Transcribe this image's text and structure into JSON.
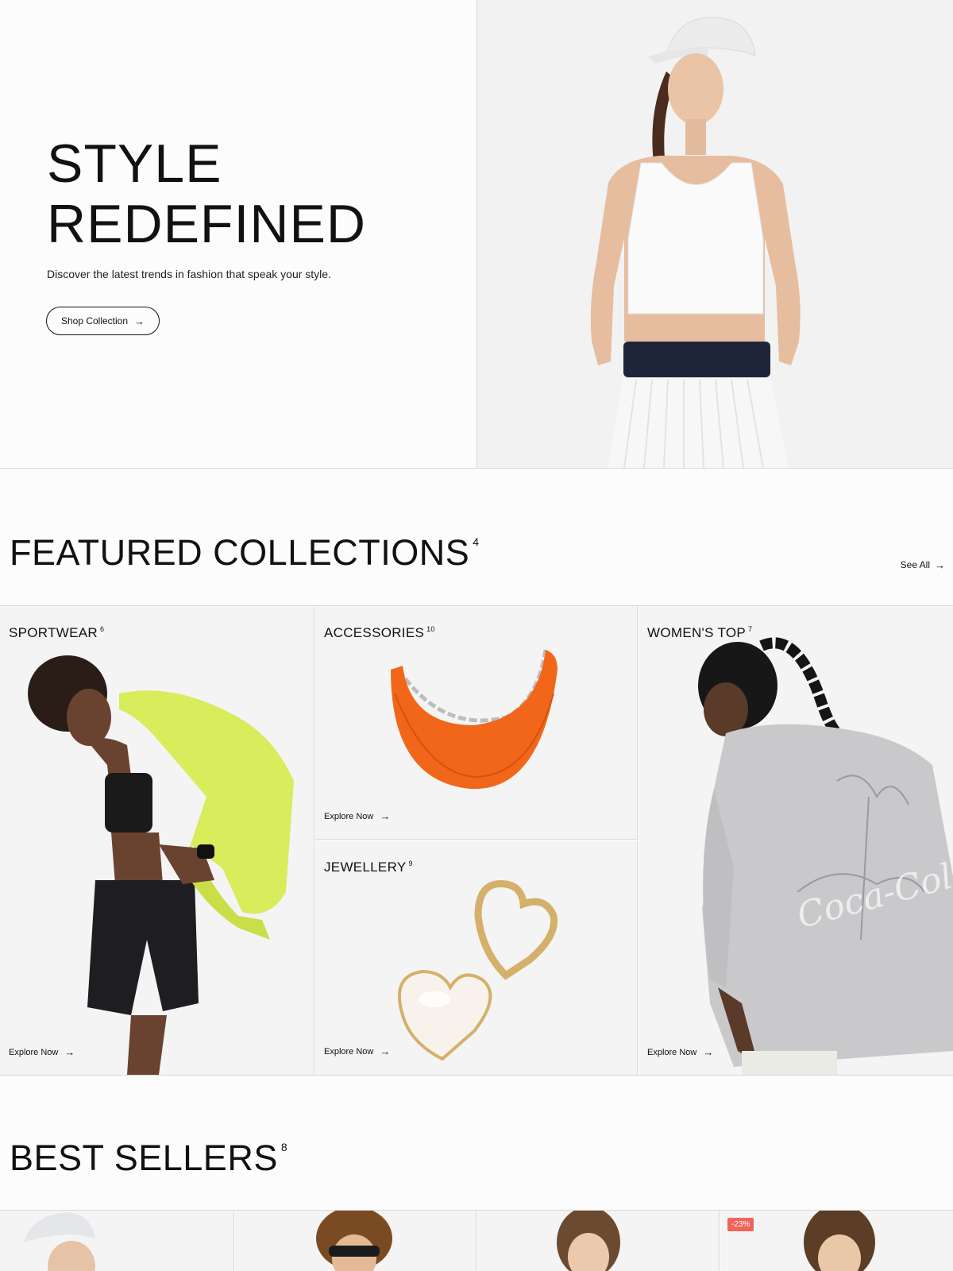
{
  "hero": {
    "title_line1": "STYLE",
    "title_line2": "REDEFINED",
    "subtitle": "Discover the latest trends in fashion that speak your style.",
    "cta_label": "Shop Collection",
    "arrow": "→"
  },
  "featured": {
    "title": "FEATURED COLLECTIONS",
    "count": "4",
    "see_all": "See All",
    "arrow": "→",
    "collections": [
      {
        "name": "SPORTWEAR",
        "count": "6",
        "cta": "Explore Now"
      },
      {
        "name": "ACCESSORIES",
        "count": "10",
        "cta": "Explore Now"
      },
      {
        "name": "JEWELLERY",
        "count": "9",
        "cta": "Explore Now"
      },
      {
        "name": "WOMEN'S TOP",
        "count": "7",
        "cta": "Explore Now"
      }
    ]
  },
  "best_sellers": {
    "title": "BEST SELLERS",
    "count": "8",
    "discount_badge": "-23%"
  },
  "colors": {
    "accent_badge": "#f0645a",
    "jacket": "#d8ec5c",
    "bag": "#f2661a"
  }
}
